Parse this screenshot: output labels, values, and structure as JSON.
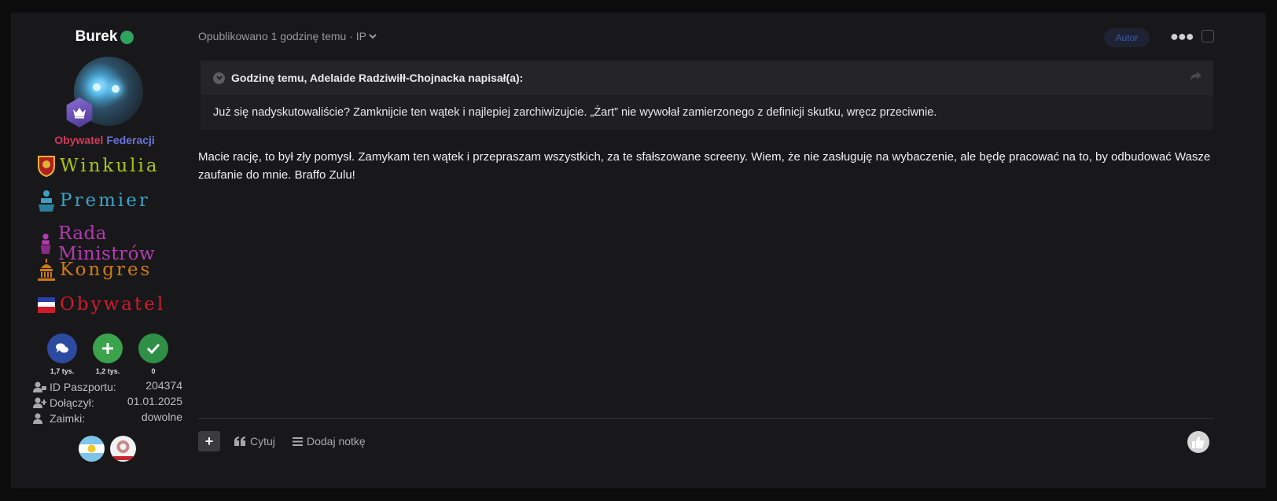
{
  "author": {
    "name": "Burek",
    "rank_part1": "Obywatel",
    "rank_part2": "Federacji",
    "roles": [
      {
        "label": "Winkulia",
        "color": "#a6c41e"
      },
      {
        "label": "Premier",
        "color": "#3ba0c4"
      },
      {
        "label": "Rada Ministrów",
        "color": "#b43bb0"
      },
      {
        "label": "Kongres",
        "color": "#d07a18"
      },
      {
        "label": "Obywatel",
        "color": "#d11a2a"
      }
    ],
    "stats": [
      {
        "icon": "comments-icon",
        "count": "1,7 tys.",
        "color": "#2c4aa0"
      },
      {
        "icon": "plus-icon",
        "count": "1,2 tys.",
        "color": "#3aa34c"
      },
      {
        "icon": "check-icon",
        "count": "0",
        "color": "#2f8f46"
      }
    ],
    "info": [
      {
        "label": "ID Paszportu:",
        "value": "204374",
        "icon": "user-id-icon"
      },
      {
        "label": "Dołączył:",
        "value": "01.01.2025",
        "icon": "user-plus-icon"
      },
      {
        "label": "Zaimki:",
        "value": "dowolne",
        "icon": "user-icon"
      }
    ]
  },
  "post": {
    "meta": "Opublikowano 1 godzinę temu · IP",
    "author_tag": "Autor",
    "quote": {
      "header": "Godzinę temu, Adelaide Radziwiłł-Chojnacka napisał(a):",
      "text": "Już się nadyskutowaliście? Zamknijcie ten wątek i najlepiej zarchiwizujcie. „Żart” nie wywołał zamierzonego z definicji skutku, wręcz przeciwnie."
    },
    "body": "Macie rację, to był zły pomysł. Zamykam ten wątek i przepraszam wszystkich, za te sfałszowane screeny. Wiem, że nie zasługuję na wybaczenie, ale będę pracować na to, by odbudować Wasze zaufanie do mnie. Braffo Zulu!"
  },
  "footer": {
    "quote_label": "Cytuj",
    "note_label": "Dodaj notkę"
  }
}
